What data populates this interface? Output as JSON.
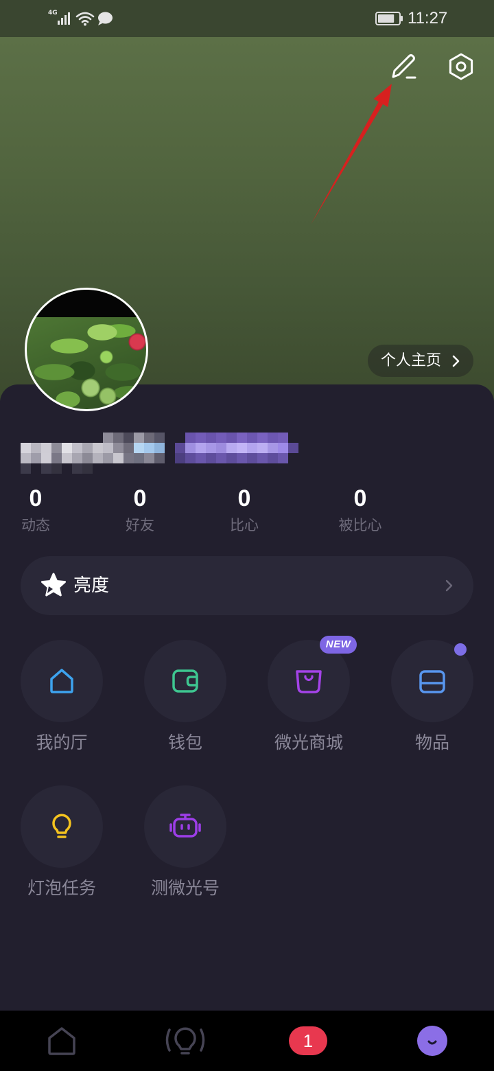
{
  "status_bar": {
    "network": "4G",
    "time": "11:27",
    "battery_level": 0.8,
    "icons": [
      "signal-icon",
      "wifi-icon",
      "chat-bubble-icon",
      "battery-icon"
    ]
  },
  "header": {
    "profile_link_label": "个人主页",
    "edit_icon": "edit-pencil-icon",
    "settings_icon": "settings-hexagon-icon"
  },
  "stats": [
    {
      "value": "0",
      "label": "动态"
    },
    {
      "value": "0",
      "label": "好友"
    },
    {
      "value": "0",
      "label": "比心"
    },
    {
      "value": "0",
      "label": "被比心"
    }
  ],
  "brightness_row": {
    "label": "亮度",
    "icon": "star-icon"
  },
  "grid": [
    {
      "label": "我的厅",
      "icon": "house-icon",
      "color": "#3da3ee"
    },
    {
      "label": "钱包",
      "icon": "wallet-icon",
      "color": "#3ec690"
    },
    {
      "label": "微光商城",
      "icon": "shopping-bag-icon",
      "color": "#a443e8",
      "badge": "NEW",
      "badge_color": "#7e66e4"
    },
    {
      "label": "物品",
      "icon": "drawer-icon",
      "color": "#5896ee",
      "dot_color": "#7d6ee6"
    },
    {
      "label": "灯泡任务",
      "icon": "lightbulb-icon",
      "color": "#f4c31f"
    },
    {
      "label": "测微光号",
      "icon": "robot-icon",
      "color": "#9d3ee8"
    }
  ],
  "bottom_nav": [
    {
      "icon": "home-icon",
      "color": "#464454"
    },
    {
      "icon": "bulb-waves-icon",
      "color": "#464454"
    },
    {
      "icon": "messages-badge",
      "badge": "1",
      "badge_color": "#e8384f"
    },
    {
      "icon": "profile-smile-icon",
      "color": "#8b6ee6"
    }
  ],
  "colors": {
    "card_background": "#221f2e",
    "header_green": "#5c7047",
    "muted_text": "#6e6b7b",
    "annotation_arrow": "#d7201f"
  }
}
